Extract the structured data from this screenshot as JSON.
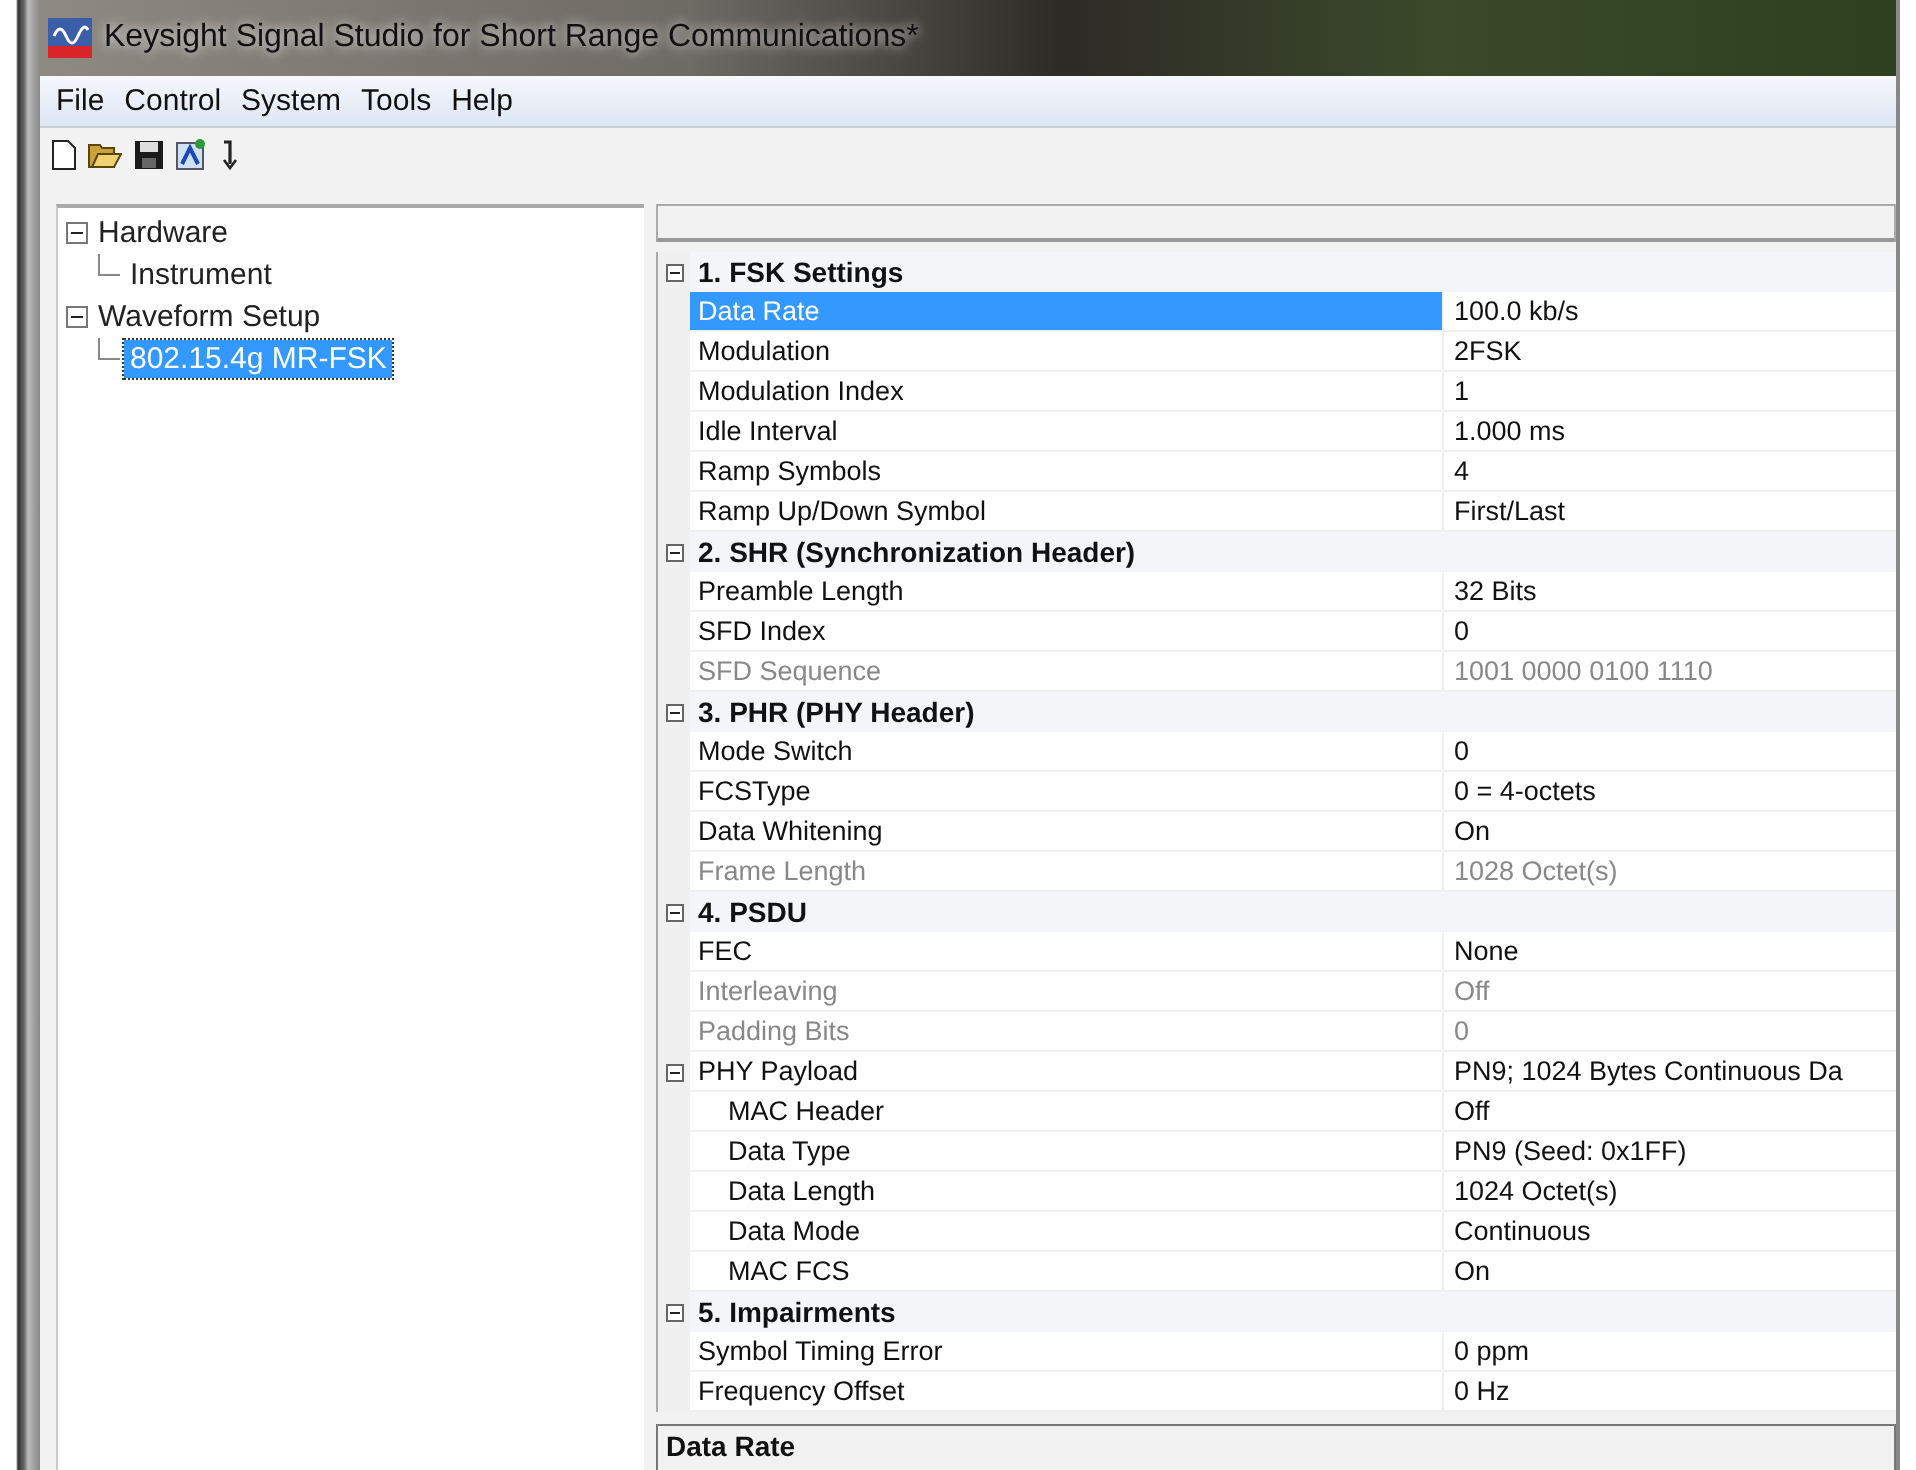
{
  "window": {
    "title": "Keysight Signal Studio for Short Range Communications*"
  },
  "menu": [
    "File",
    "Control",
    "System",
    "Tools",
    "Help"
  ],
  "tree": [
    {
      "label": "Hardware",
      "expanded": true,
      "selected": false,
      "children": [
        {
          "label": "Instrument",
          "selected": false
        }
      ]
    },
    {
      "label": "Waveform Setup",
      "expanded": true,
      "selected": false,
      "children": [
        {
          "label": "802.15.4g MR-FSK",
          "selected": true
        }
      ]
    }
  ],
  "property_grid": {
    "categories": [
      {
        "title": "1. FSK Settings",
        "expanded": true,
        "rows": [
          {
            "label": "Data Rate",
            "value": "100.0 kb/s",
            "selected": true,
            "disabled": false
          },
          {
            "label": "Modulation",
            "value": "2FSK",
            "selected": false,
            "disabled": false
          },
          {
            "label": "Modulation Index",
            "value": "1",
            "selected": false,
            "disabled": false
          },
          {
            "label": "Idle Interval",
            "value": "1.000 ms",
            "selected": false,
            "disabled": false
          },
          {
            "label": "Ramp Symbols",
            "value": "4",
            "selected": false,
            "disabled": false
          },
          {
            "label": "Ramp Up/Down Symbol",
            "value": "First/Last",
            "selected": false,
            "disabled": false
          }
        ]
      },
      {
        "title": "2. SHR (Synchronization Header)",
        "expanded": true,
        "rows": [
          {
            "label": "Preamble Length",
            "value": "32 Bits",
            "selected": false,
            "disabled": false
          },
          {
            "label": "SFD Index",
            "value": "0",
            "selected": false,
            "disabled": false
          },
          {
            "label": "SFD Sequence",
            "value": "1001 0000 0100 1110",
            "selected": false,
            "disabled": true
          }
        ]
      },
      {
        "title": "3. PHR (PHY Header)",
        "expanded": true,
        "rows": [
          {
            "label": "Mode Switch",
            "value": "0",
            "selected": false,
            "disabled": false
          },
          {
            "label": "FCSType",
            "value": "0 = 4-octets",
            "selected": false,
            "disabled": false
          },
          {
            "label": "Data Whitening",
            "value": "On",
            "selected": false,
            "disabled": false
          },
          {
            "label": "Frame Length",
            "value": "1028 Octet(s)",
            "selected": false,
            "disabled": true
          }
        ]
      },
      {
        "title": "4. PSDU",
        "expanded": true,
        "rows": [
          {
            "label": "FEC",
            "value": "None",
            "selected": false,
            "disabled": false
          },
          {
            "label": "Interleaving",
            "value": "Off",
            "selected": false,
            "disabled": true
          },
          {
            "label": "Padding Bits",
            "value": "0",
            "selected": false,
            "disabled": true
          },
          {
            "label": "PHY Payload",
            "value": "PN9; 1024 Bytes Continuous Da",
            "selected": false,
            "disabled": false,
            "expanded": true,
            "children": [
              {
                "label": "MAC Header",
                "value": "Off",
                "selected": false,
                "disabled": false
              },
              {
                "label": "Data Type",
                "value": "PN9 (Seed: 0x1FF)",
                "selected": false,
                "disabled": false
              },
              {
                "label": "Data Length",
                "value": "1024 Octet(s)",
                "selected": false,
                "disabled": false
              },
              {
                "label": "Data Mode",
                "value": "Continuous",
                "selected": false,
                "disabled": false
              },
              {
                "label": "MAC FCS",
                "value": "On",
                "selected": false,
                "disabled": false
              }
            ]
          }
        ]
      },
      {
        "title": "5. Impairments",
        "expanded": true,
        "rows": [
          {
            "label": "Symbol Timing Error",
            "value": "0 ppm",
            "selected": false,
            "disabled": false
          },
          {
            "label": "Frequency Offset",
            "value": "0 Hz",
            "selected": false,
            "disabled": false
          }
        ]
      }
    ]
  },
  "description": {
    "title": "Data Rate"
  }
}
